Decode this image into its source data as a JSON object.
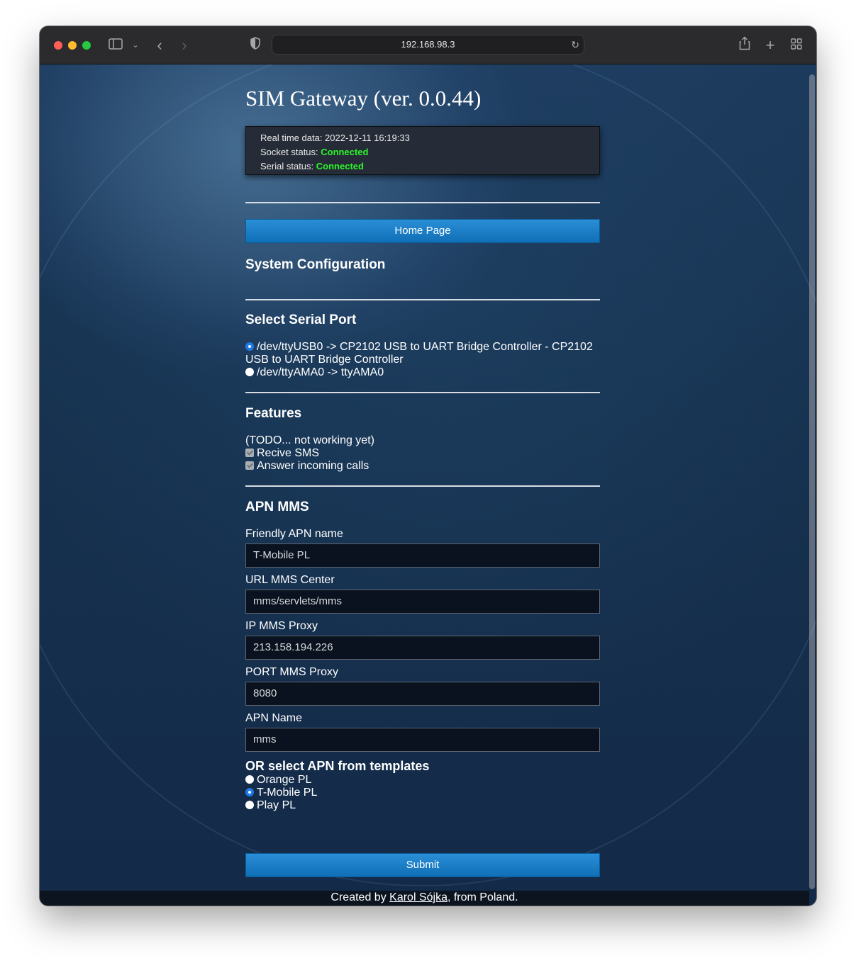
{
  "browser": {
    "url": "192.168.98.3"
  },
  "page": {
    "title": "SIM Gateway (ver. 0.0.44)",
    "realtime": {
      "data_label": "Real time data: 2022-12-11 16:19:33",
      "socket_label": "Socket status:",
      "socket_value": "Connected",
      "serial_label": "Serial status:",
      "serial_value": "Connected"
    },
    "home_button": "Home Page",
    "system_config_heading": "System Configuration",
    "serial_port": {
      "heading": "Select Serial Port",
      "options": [
        {
          "line1": "/dev/ttyUSB0 -> CP2102 USB to UART Bridge Controller - CP2102",
          "line2": "USB to UART Bridge Controller",
          "selected": true
        },
        {
          "line1": "/dev/ttyAMA0 -> ttyAMA0",
          "selected": false
        }
      ]
    },
    "features": {
      "heading": "Features",
      "note": "(TODO... not working yet)",
      "items": [
        "Recive SMS",
        "Answer incoming calls"
      ]
    },
    "apn": {
      "heading": "APN MMS",
      "fields": [
        {
          "label": "Friendly APN name",
          "value": "T-Mobile PL"
        },
        {
          "label": "URL MMS Center",
          "value": "mms/servlets/mms"
        },
        {
          "label": "IP MMS Proxy",
          "value": "213.158.194.226"
        },
        {
          "label": "PORT MMS Proxy",
          "value": "8080"
        },
        {
          "label": "APN Name",
          "value": "mms"
        }
      ],
      "templates_heading": "OR select APN from templates",
      "templates": [
        {
          "label": "Orange PL",
          "selected": false
        },
        {
          "label": "T-Mobile PL",
          "selected": true
        },
        {
          "label": "Play PL",
          "selected": false
        }
      ]
    },
    "submit_button": "Submit",
    "footer": {
      "prefix": "Created by ",
      "author": "Karol Sójka",
      "suffix": ", from Poland."
    }
  }
}
